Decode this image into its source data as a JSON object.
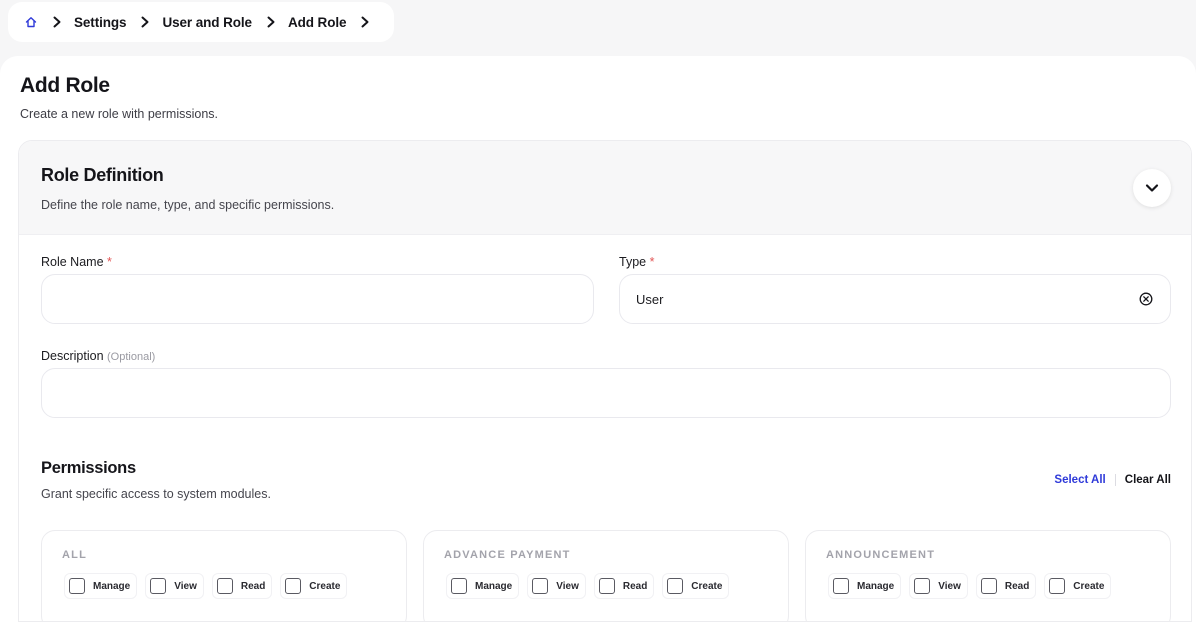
{
  "breadcrumb": {
    "items": [
      "Settings",
      "User and Role",
      "Add Role"
    ]
  },
  "page": {
    "title": "Add Role",
    "subtitle": "Create a new role with permissions."
  },
  "role_definition": {
    "title": "Role Definition",
    "description": "Define the role name, type, and specific permissions."
  },
  "form": {
    "role_name_label": "Role Name",
    "required_marker": "*",
    "role_name_value": "",
    "type_label": "Type",
    "type_value": "User",
    "description_label": "Description",
    "description_optional": "(Optional)",
    "description_value": ""
  },
  "permissions": {
    "title": "Permissions",
    "description": "Grant specific access to system modules.",
    "select_all": "Select All",
    "clear_all": "Clear All",
    "modules": [
      {
        "name": "ALL",
        "actions": [
          "Manage",
          "View",
          "Read",
          "Create"
        ]
      },
      {
        "name": "ADVANCE PAYMENT",
        "actions": [
          "Manage",
          "View",
          "Read",
          "Create"
        ]
      },
      {
        "name": "ANNOUNCEMENT",
        "actions": [
          "Manage",
          "View",
          "Read",
          "Create"
        ]
      }
    ]
  },
  "colors": {
    "accent": "#2f3ad9",
    "required": "#e25555"
  },
  "icons": [
    "home-icon",
    "chevron-right-icon",
    "chevron-down-icon",
    "clear-icon"
  ]
}
